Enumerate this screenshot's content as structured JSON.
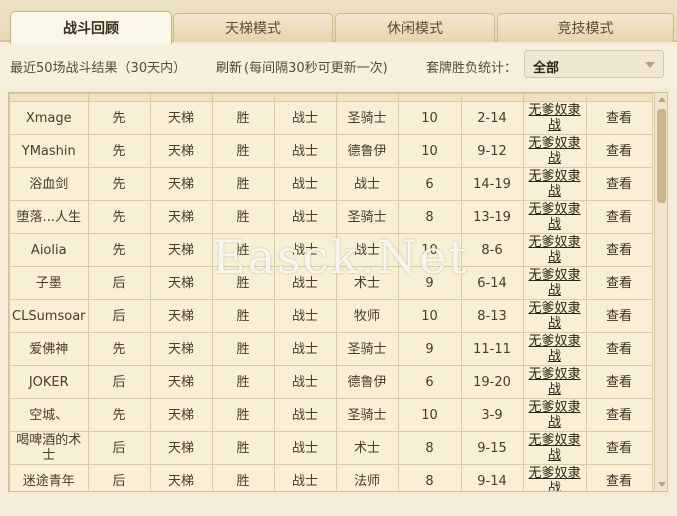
{
  "tabs": [
    {
      "label": "战斗回顾",
      "active": true
    },
    {
      "label": "天梯模式",
      "active": false
    },
    {
      "label": "休闲模式",
      "active": false
    },
    {
      "label": "竞技模式",
      "active": false
    }
  ],
  "filter": {
    "summary": "最近50场战斗结果（30天内）",
    "refresh_label": "刷新",
    "refresh_note": "(每间隔30秒可更新一次)",
    "deck_stats_label": "套牌胜负统计：",
    "deck_stats_value": "全部"
  },
  "rows": [
    {
      "name": "Xmage",
      "order": "先",
      "mode": "天梯",
      "result": "胜",
      "hero": "战士",
      "opponent": "圣骑士",
      "turns": "10",
      "score": "2-14",
      "mode_link": "无爹奴隶战",
      "action": "查看"
    },
    {
      "name": "YMashin",
      "order": "先",
      "mode": "天梯",
      "result": "胜",
      "hero": "战士",
      "opponent": "德鲁伊",
      "turns": "10",
      "score": "9-12",
      "mode_link": "无爹奴隶战",
      "action": "查看"
    },
    {
      "name": "浴血剑",
      "order": "先",
      "mode": "天梯",
      "result": "胜",
      "hero": "战士",
      "opponent": "战士",
      "turns": "6",
      "score": "14-19",
      "mode_link": "无爹奴隶战",
      "action": "查看"
    },
    {
      "name": "堕落...人生",
      "order": "先",
      "mode": "天梯",
      "result": "胜",
      "hero": "战士",
      "opponent": "圣骑士",
      "turns": "8",
      "score": "13-19",
      "mode_link": "无爹奴隶战",
      "action": "查看"
    },
    {
      "name": "Aiolia",
      "order": "先",
      "mode": "天梯",
      "result": "胜",
      "hero": "战士",
      "opponent": "战士",
      "turns": "10",
      "score": "8-6",
      "mode_link": "无爹奴隶战",
      "action": "查看"
    },
    {
      "name": "子墨",
      "order": "后",
      "mode": "天梯",
      "result": "胜",
      "hero": "战士",
      "opponent": "术士",
      "turns": "9",
      "score": "6-14",
      "mode_link": "无爹奴隶战",
      "action": "查看"
    },
    {
      "name": "CLSumsoar",
      "order": "后",
      "mode": "天梯",
      "result": "胜",
      "hero": "战士",
      "opponent": "牧师",
      "turns": "10",
      "score": "8-13",
      "mode_link": "无爹奴隶战",
      "action": "查看"
    },
    {
      "name": "爱佛神",
      "order": "先",
      "mode": "天梯",
      "result": "胜",
      "hero": "战士",
      "opponent": "圣骑士",
      "turns": "9",
      "score": "11-11",
      "mode_link": "无爹奴隶战",
      "action": "查看"
    },
    {
      "name": "JOKER",
      "order": "后",
      "mode": "天梯",
      "result": "胜",
      "hero": "战士",
      "opponent": "德鲁伊",
      "turns": "6",
      "score": "19-20",
      "mode_link": "无爹奴隶战",
      "action": "查看"
    },
    {
      "name": "空城、",
      "order": "先",
      "mode": "天梯",
      "result": "胜",
      "hero": "战士",
      "opponent": "圣骑士",
      "turns": "10",
      "score": "3-9",
      "mode_link": "无爹奴隶战",
      "action": "查看"
    },
    {
      "name": "喝啤酒的术士",
      "order": "后",
      "mode": "天梯",
      "result": "胜",
      "hero": "战士",
      "opponent": "术士",
      "turns": "8",
      "score": "9-15",
      "mode_link": "无爹奴隶战",
      "action": "查看"
    },
    {
      "name": "迷途青年",
      "order": "后",
      "mode": "天梯",
      "result": "胜",
      "hero": "战士",
      "opponent": "法师",
      "turns": "8",
      "score": "9-14",
      "mode_link": "无爹奴隶战",
      "action": "查看"
    }
  ],
  "watermark": "Easck.Net"
}
